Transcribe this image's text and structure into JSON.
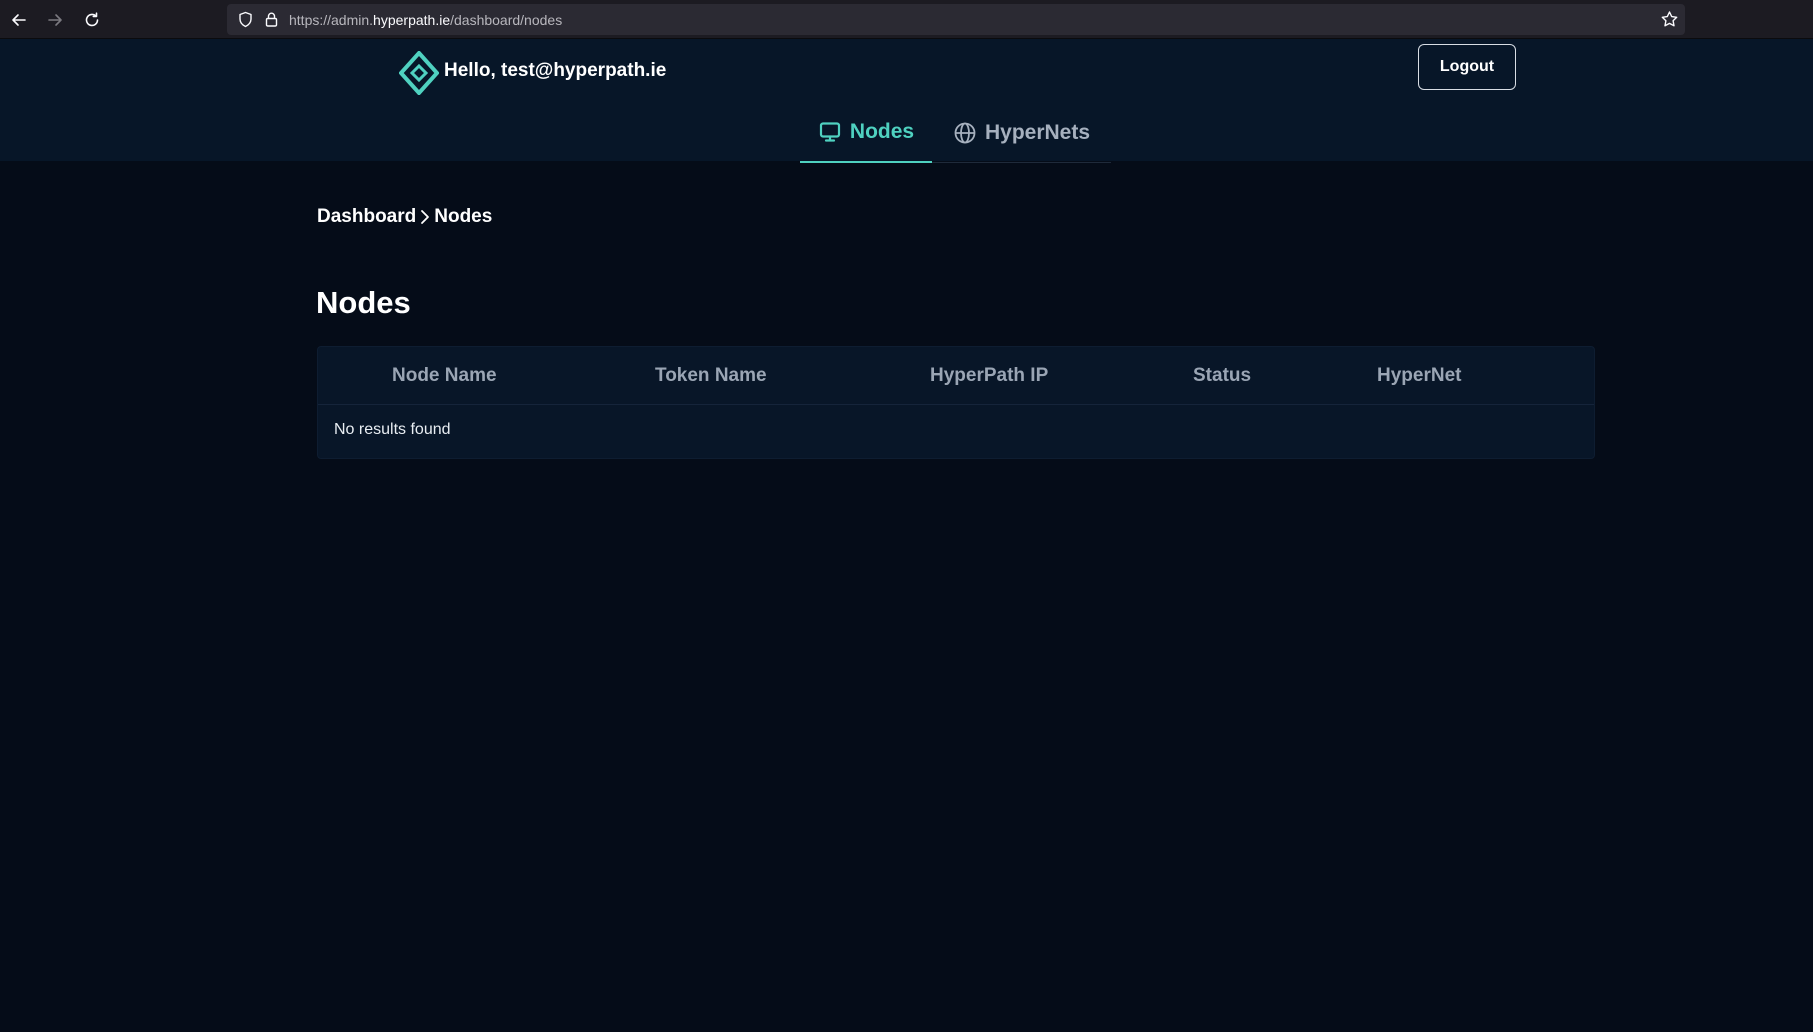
{
  "browser": {
    "url_prefix": "https://admin.",
    "url_host": "hyperpath.ie",
    "url_path": "/dashboard/nodes"
  },
  "header": {
    "greeting": "Hello, test@hyperpath.ie",
    "logout_label": "Logout",
    "accent_color": "#4fd1c0",
    "tabs": [
      {
        "label": "Nodes",
        "icon": "monitor-icon",
        "active": true
      },
      {
        "label": "HyperNets",
        "icon": "globe-icon",
        "active": false
      }
    ]
  },
  "breadcrumb": {
    "items": [
      "Dashboard",
      "Nodes"
    ]
  },
  "main": {
    "title": "Nodes",
    "table": {
      "columns": [
        "Node Name",
        "Token Name",
        "HyperPath IP",
        "Status",
        "HyperNet"
      ],
      "empty_text": "No results found"
    }
  }
}
